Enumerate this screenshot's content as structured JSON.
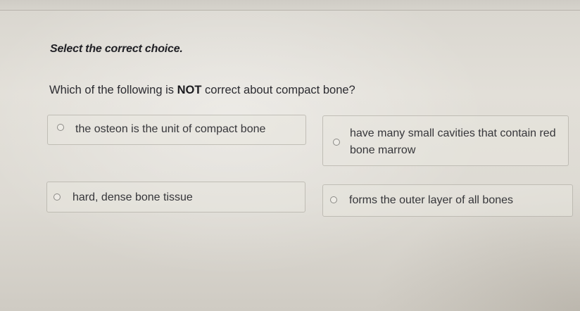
{
  "instruction": "Select the correct choice.",
  "question": {
    "prefix": "Which of the following is ",
    "emphasis": "NOT",
    "suffix": " correct about compact bone?"
  },
  "choices": [
    {
      "text": "the osteon is the unit of compact bone",
      "selected": false
    },
    {
      "text": "have many small cavities that contain red bone marrow",
      "selected": false
    },
    {
      "text": "hard, dense bone tissue",
      "selected": false
    },
    {
      "text": "forms the outer layer of all bones",
      "selected": false
    }
  ]
}
